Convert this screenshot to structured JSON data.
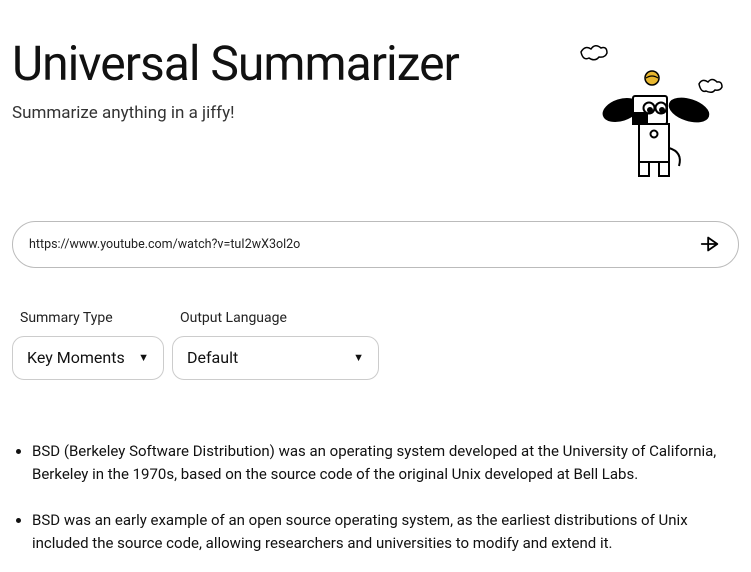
{
  "header": {
    "title": "Universal Summarizer",
    "subtitle": "Summarize anything in a jiffy!"
  },
  "input": {
    "value": "https://www.youtube.com/watch?v=tuI2wX3ol2o"
  },
  "controls": {
    "summary_type": {
      "label": "Summary Type",
      "value": "Key Moments"
    },
    "output_language": {
      "label": "Output Language",
      "value": "Default"
    }
  },
  "results": {
    "items": [
      "BSD (Berkeley Software Distribution) was an operating system developed at the University of California, Berkeley in the 1970s, based on the source code of the original Unix developed at Bell Labs.",
      "BSD was an early example of an open source operating system, as the earliest distributions of Unix included the source code, allowing researchers and universities to modify and extend it."
    ]
  }
}
